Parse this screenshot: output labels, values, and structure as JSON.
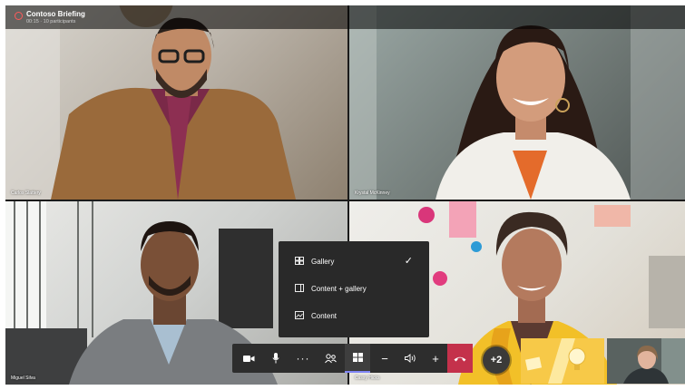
{
  "header": {
    "meeting_title": "Contoso Briefing",
    "meeting_time": "00:15 · 10 participants"
  },
  "tiles": [
    {
      "name": "Carlos Slattery"
    },
    {
      "name": "Krystal McKinney"
    },
    {
      "name": "Miguel Silva"
    },
    {
      "name": "Cassy Hicks"
    }
  ],
  "layout_menu": {
    "items": [
      {
        "label": "Gallery",
        "icon": "gallery-icon",
        "selected": true
      },
      {
        "label": "Content + gallery",
        "icon": "content-gallery-icon",
        "selected": false
      },
      {
        "label": "Content",
        "icon": "content-icon",
        "selected": false
      }
    ]
  },
  "controls": {
    "overflow_count": "+2",
    "icons": [
      "camera-icon",
      "microphone-icon",
      "more-icon",
      "participants-icon",
      "layout-icon",
      "zoom-out-icon",
      "volume-icon",
      "zoom-in-icon",
      "hang-up-icon"
    ]
  },
  "colors": {
    "accent": "#7f85f5",
    "hangup": "#c4314b",
    "menu_bg": "#292929",
    "recording": "#ff5a5a"
  }
}
